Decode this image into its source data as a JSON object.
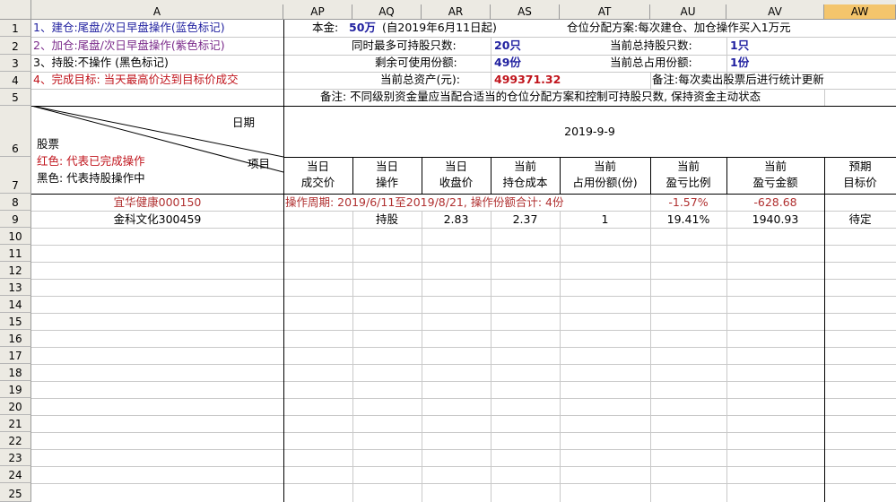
{
  "columns": [
    "A",
    "AP",
    "AQ",
    "AR",
    "AS",
    "AT",
    "AU",
    "AV",
    "AW"
  ],
  "rows": [
    "1",
    "2",
    "3",
    "4",
    "5",
    "6",
    "7",
    "8",
    "9",
    "10",
    "11",
    "12",
    "13",
    "14",
    "15",
    "16",
    "17",
    "18",
    "19",
    "20",
    "21",
    "22",
    "23",
    "24",
    "25"
  ],
  "legend": {
    "line1": "1、建仓:尾盘/次日早盘操作(蓝色标记)",
    "line2": "2、加仓:尾盘/次日早盘操作(紫色标记)",
    "line3": "3、持股:不操作 (黑色标记)",
    "line4": "4、完成目标: 当天最高价达到目标价成交"
  },
  "summary": {
    "capital_label": "本金:",
    "capital_value": "50万",
    "capital_note": "(自2019年6月11日起)",
    "plan_text": "仓位分配方案:每次建仓、加仓操作买入1万元",
    "max_hold_label": "同时最多可持股只数:",
    "max_hold_value": "20只",
    "current_hold_label": "当前总持股只数:",
    "current_hold_value": "1只",
    "remaining_label": "剩余可使用份额:",
    "remaining_value": "49份",
    "used_label": "当前总占用份额:",
    "used_value": "1份",
    "assets_label": "当前总资产(元):",
    "assets_value": "499371.32",
    "assets_note": "备注:每次卖出股票后进行统计更新",
    "remark": "备注: 不同级别资金量应当配合适当的仓位分配方案和控制可持股只数, 保持资金主动状态"
  },
  "header": {
    "date_label": "日期",
    "stock_label": "股票",
    "item_label": "项目",
    "red_note": "红色: 代表已完成操作",
    "black_note": "黑色: 代表持股操作中",
    "date_value": "2019-9-9",
    "col_headers": [
      {
        "l1": "当日",
        "l2": "成交价"
      },
      {
        "l1": "当日",
        "l2": "操作"
      },
      {
        "l1": "当日",
        "l2": "收盘价"
      },
      {
        "l1": "当前",
        "l2": "持仓成本"
      },
      {
        "l1": "当前",
        "l2": "占用份额(份)"
      },
      {
        "l1": "当前",
        "l2": "盈亏比例"
      },
      {
        "l1": "当前",
        "l2": "盈亏金额"
      },
      {
        "l1": "预期",
        "l2": "目标价"
      }
    ]
  },
  "data_rows": [
    {
      "stock": "宜华健康000150",
      "cycle_text": "操作周期: 2019/6/11至2019/8/21, 操作份额合计: 4份",
      "pnl_ratio": "-1.57%",
      "pnl_amount": "-628.68"
    },
    {
      "stock": "金科文化300459",
      "operation": "持股",
      "close": "2.83",
      "cost": "2.37",
      "shares": "1",
      "pnl_ratio": "19.41%",
      "pnl_amount": "1940.93",
      "target": "待定"
    }
  ]
}
